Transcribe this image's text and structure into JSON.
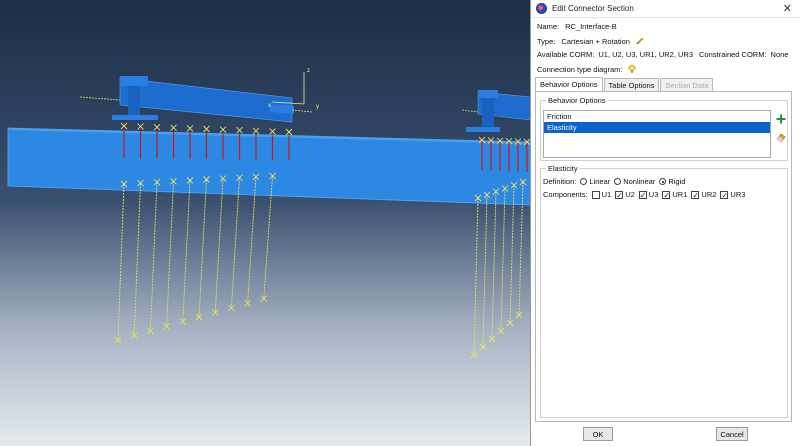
{
  "dialog": {
    "title": "Edit Connector Section",
    "close_glyph": "✕",
    "name_label": "Name:",
    "name_value": "RC_Interface-B",
    "type_label": "Type:",
    "type_value": "Cartesian + Rotation",
    "available_corm_label": "Available CORM:",
    "available_corm_value": "U1, U2, U3, UR1, UR2, UR3",
    "constrained_corm_label": "Constrained CORM:",
    "constrained_corm_value": "None",
    "connection_diagram_label": "Connection type diagram:",
    "tabs": [
      {
        "label": "Behavior Options",
        "state": "active"
      },
      {
        "label": "Table Options",
        "state": "normal"
      },
      {
        "label": "Section Data",
        "state": "disabled"
      }
    ],
    "behavior_options": {
      "group_label": "Behavior Options",
      "items": [
        {
          "label": "Friction",
          "selected": false
        },
        {
          "label": "Elasticity",
          "selected": true
        }
      ]
    },
    "elasticity": {
      "group_label": "Elasticity",
      "definition_label": "Definition:",
      "definition_options": [
        {
          "label": "Linear",
          "checked": false
        },
        {
          "label": "Nonlinear",
          "checked": false
        },
        {
          "label": "Rigid",
          "checked": true
        }
      ],
      "components_label": "Components:",
      "components": [
        {
          "label": "U1",
          "checked": false
        },
        {
          "label": "U2",
          "checked": true
        },
        {
          "label": "U3",
          "checked": true
        },
        {
          "label": "UR1",
          "checked": true
        },
        {
          "label": "UR2",
          "checked": true
        },
        {
          "label": "UR3",
          "checked": true
        }
      ],
      "check_glyph": "✓"
    },
    "ok_label": "OK",
    "cancel_label": "Cancel"
  },
  "viewport": {
    "triad_labels": {
      "x": "x",
      "y": "y",
      "z": "z"
    },
    "colors": {
      "background_top": "#1f3350",
      "background_bottom": "#e4e8ee",
      "slab": "#2a86e0",
      "girder": "#1f6ed0",
      "connector": "#e8e060",
      "rigid_link": "#c81818"
    }
  }
}
